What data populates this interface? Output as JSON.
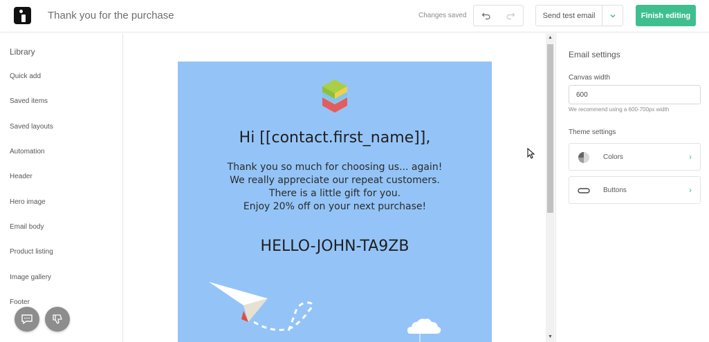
{
  "header": {
    "title": "Thank you for the purchase",
    "status": "Changes saved",
    "send_test_label": "Send test email",
    "finish_label": "Finish editing"
  },
  "sidebar": {
    "title": "Library",
    "items": [
      {
        "label": "Quick add"
      },
      {
        "label": "Saved items"
      },
      {
        "label": "Saved layouts"
      },
      {
        "label": "Automation"
      },
      {
        "label": "Header"
      },
      {
        "label": "Hero image"
      },
      {
        "label": "Email body"
      },
      {
        "label": "Product listing"
      },
      {
        "label": "Image gallery"
      },
      {
        "label": "Footer"
      }
    ]
  },
  "email": {
    "greeting": "Hi [[contact.first_name]],",
    "body_lines": [
      "Thank you so much for choosing us... again!",
      "We really appreciate our repeat customers.",
      "There is a little gift for you.",
      "Enjoy 20% off on your next purchase!"
    ],
    "code": "HELLO-JOHN-TA9ZB"
  },
  "settings": {
    "title": "Email settings",
    "canvas_width_label": "Canvas width",
    "canvas_width_value": "600",
    "canvas_width_hint": "We recommend using a 600-700px width",
    "theme_label": "Theme settings",
    "theme_items": [
      {
        "label": "Colors",
        "icon": "pie-icon"
      },
      {
        "label": "Buttons",
        "icon": "button-shape-icon"
      }
    ]
  },
  "colors": {
    "accent": "#3fbf8f",
    "email_bg": "#94c4f7"
  }
}
